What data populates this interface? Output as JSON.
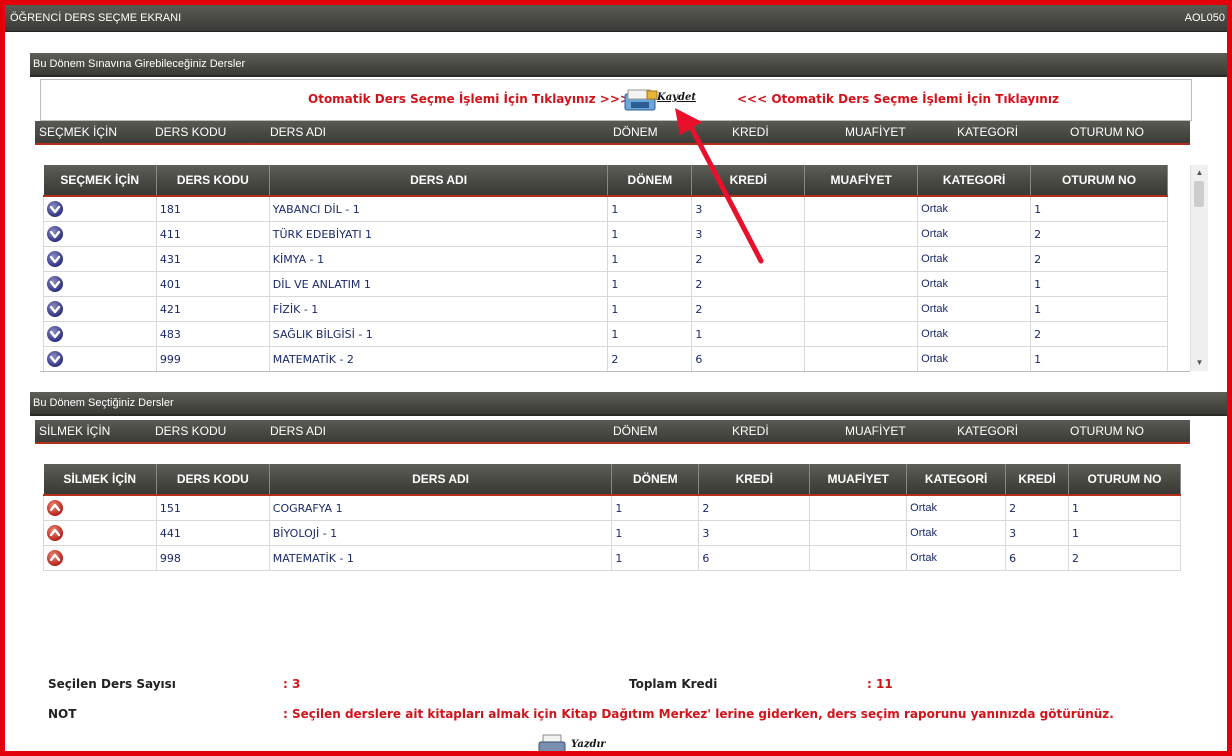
{
  "app": {
    "title": "ÖĞRENCİ DERS SEÇME EKRANI",
    "user_code": "AOL050"
  },
  "available": {
    "section_title": "Bu Dönem Sınavına Girebileceğiniz  Dersler",
    "auto_left": "Otomatik Ders Seçme İşlemi İçin Tıklayınız >>>",
    "auto_right": "<<< Otomatik Ders Seçme İşlemi İçin Tıklayınız",
    "save_label": "Kaydet",
    "outer_headers": [
      "SEÇMEK İÇİN",
      "DERS KODU",
      "DERS ADI",
      "DÖNEM",
      "KREDİ",
      "MUAFİYET",
      "KATEGORİ",
      "OTURUM NO"
    ],
    "headers": [
      "SEÇMEK İÇİN",
      "DERS KODU",
      "DERS ADI",
      "DÖNEM",
      "KREDİ",
      "MUAFİYET",
      "KATEGORİ",
      "OTURUM NO"
    ],
    "rows": [
      {
        "code": "181",
        "name": "YABANCI DİL - 1",
        "term": "1",
        "credit": "3",
        "exempt": "",
        "category": "Ortak",
        "session": "1"
      },
      {
        "code": "411",
        "name": "TÜRK EDEBİYATI 1",
        "term": "1",
        "credit": "3",
        "exempt": "",
        "category": "Ortak",
        "session": "2"
      },
      {
        "code": "431",
        "name": "KİMYA - 1",
        "term": "1",
        "credit": "2",
        "exempt": "",
        "category": "Ortak",
        "session": "2"
      },
      {
        "code": "401",
        "name": "DİL VE ANLATIM 1",
        "term": "1",
        "credit": "2",
        "exempt": "",
        "category": "Ortak",
        "session": "1"
      },
      {
        "code": "421",
        "name": "FİZİK - 1",
        "term": "1",
        "credit": "2",
        "exempt": "",
        "category": "Ortak",
        "session": "1"
      },
      {
        "code": "483",
        "name": "SAĞLIK BİLGİSİ - 1",
        "term": "1",
        "credit": "1",
        "exempt": "",
        "category": "Ortak",
        "session": "2"
      },
      {
        "code": "999",
        "name": "MATEMATİK - 2",
        "term": "2",
        "credit": "6",
        "exempt": "",
        "category": "Ortak",
        "session": "1"
      }
    ]
  },
  "selected": {
    "section_title": "Bu Dönem Seçtiğiniz Dersler",
    "outer_headers": [
      "SİLMEK İÇİN",
      "DERS KODU",
      "DERS ADI",
      "DÖNEM",
      "KREDİ",
      "MUAFİYET",
      "KATEGORİ",
      "OTURUM NO"
    ],
    "headers": [
      "SİLMEK İÇİN",
      "DERS KODU",
      "DERS ADI",
      "DÖNEM",
      "KREDİ",
      "MUAFİYET",
      "KATEGORİ",
      "KREDİ",
      "OTURUM NO"
    ],
    "rows": [
      {
        "code": "151",
        "name": "COGRAFYA 1",
        "term": "1",
        "credit": "2",
        "exempt": "",
        "category": "Ortak",
        "credit2": "2",
        "session": "1"
      },
      {
        "code": "441",
        "name": "BİYOLOJİ - 1",
        "term": "1",
        "credit": "3",
        "exempt": "",
        "category": "Ortak",
        "credit2": "3",
        "session": "1"
      },
      {
        "code": "998",
        "name": "MATEMATİK - 1",
        "term": "1",
        "credit": "6",
        "exempt": "",
        "category": "Ortak",
        "credit2": "6",
        "session": "2"
      }
    ]
  },
  "summary": {
    "count_label": "Seçilen Ders Sayısı",
    "count_value": ": 3",
    "credit_label": "Toplam Kredi",
    "credit_value": ": 11",
    "note_label": "NOT",
    "note_text": ": Seçilen derslere ait kitapları almak için Kitap Dağıtım Merkez' lerine giderken, ders seçim raporunu yanınızda götürünüz.",
    "print_label": "Yazdır"
  },
  "colors": {
    "frame": "#e4000b",
    "accent_red": "#d0141a",
    "header_dark": "#3b3b37",
    "row_text": "#1a2a6a"
  }
}
